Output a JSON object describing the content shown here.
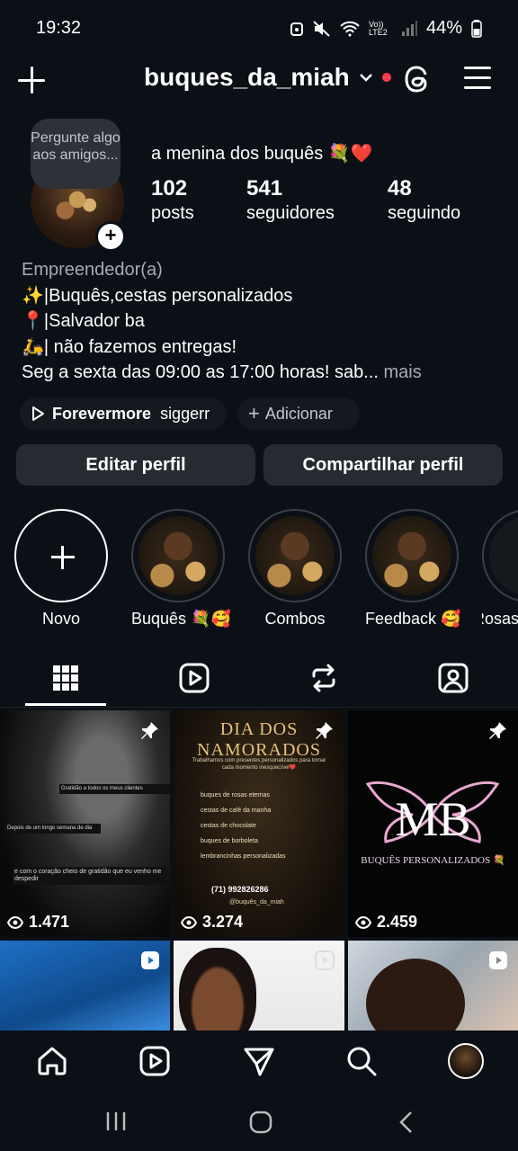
{
  "status": {
    "time": "19:32",
    "network": "Vo)) LTE2",
    "battery": "44%"
  },
  "header": {
    "username": "buques_da_miah"
  },
  "profile": {
    "note_bubble": "Pergunte algo aos amigos...",
    "display_name": "a menina dos buquês 💐❤️",
    "stats": [
      {
        "value": "102",
        "label": "posts"
      },
      {
        "value": "541",
        "label": "seguidores"
      },
      {
        "value": "48",
        "label": "seguindo"
      }
    ],
    "category": "Empreendedor(a)",
    "bio_lines": [
      "✨|Buquês,cestas personalizados",
      "📍|Salvador ba",
      "🛵| não fazemos entregas!"
    ],
    "bio_last": "Seg a sexta das 09:00 as 17:00 horas! sab...",
    "more": " mais",
    "chip_music_title": "Forevermore",
    "chip_music_artist": "siggerr",
    "chip_add": "Adicionar",
    "edit_button": "Editar perfil",
    "share_button": "Compartilhar perfil"
  },
  "highlights": [
    {
      "label": "Novo"
    },
    {
      "label": "Buquês 💐🥰"
    },
    {
      "label": "Combos"
    },
    {
      "label": "Feedback 🥰"
    },
    {
      "label": "Rosas"
    }
  ],
  "posts": [
    {
      "views": "1.471",
      "pinned": true,
      "caption_lines": [
        "Gratidão a todos os meus clientes",
        "Depois de um longo semana de dia",
        "e com o coração cheio de gratidão que eu venho me despedir"
      ]
    },
    {
      "views": "3.274",
      "pinned": true,
      "title": "DIA DOS NAMORADOS",
      "subtitle": "Trabalhamos com presentes personalizados para tornar cada momento inesquecível❤️",
      "items": [
        "buques de rosas eternas",
        "cestas de café da manha",
        "cestas de chocolate",
        "buques de borboleta",
        "lembrancinhas personalizadas"
      ],
      "phone": "(71) 992826286",
      "handle": "@buquês_da_miah"
    },
    {
      "views": "2.459",
      "pinned": true,
      "logo": "MB",
      "logo_sub": "BUQUÊS PERSONALIZADOS 💐"
    },
    {
      "video": true
    },
    {
      "video": true
    },
    {
      "video": true
    }
  ]
}
